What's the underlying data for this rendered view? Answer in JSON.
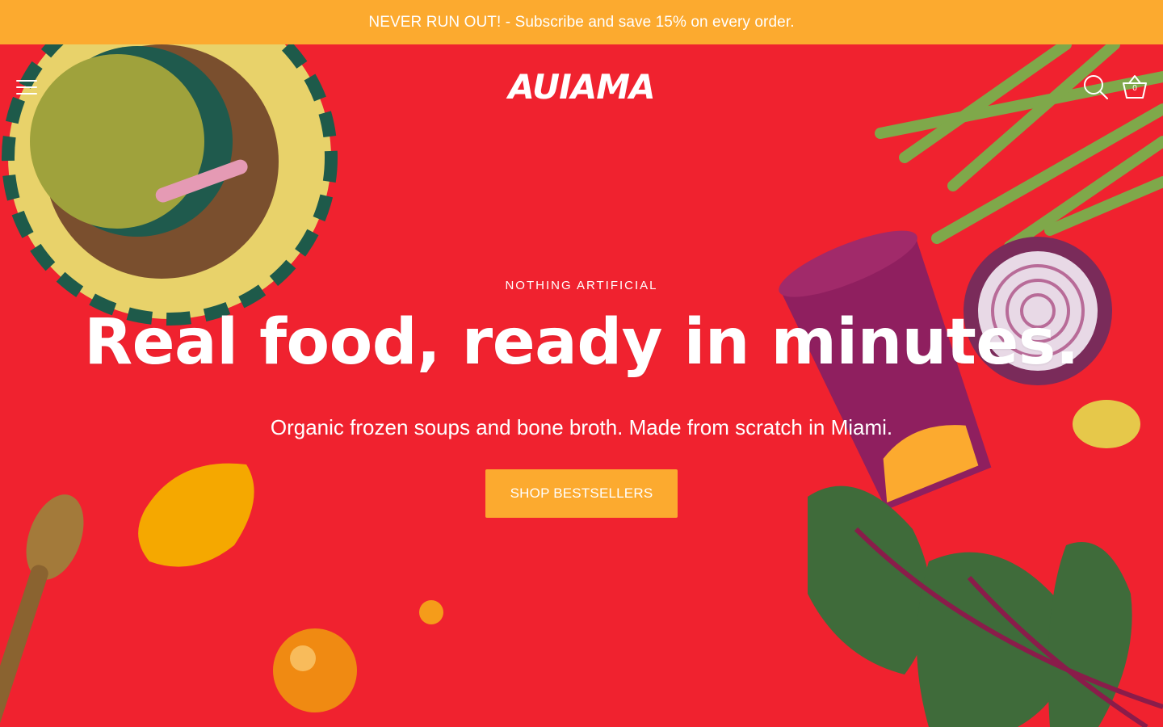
{
  "announcement": {
    "text": "NEVER RUN OUT! - Subscribe and save 15% on every order."
  },
  "header": {
    "logo": "AUIAMA",
    "cart_count": "0"
  },
  "hero": {
    "eyebrow": "NOTHING ARTIFICIAL",
    "headline": "Real food, ready in minutes.",
    "subhead": "Organic frozen soups and bone broth. Made from scratch in Miami.",
    "cta": "SHOP BESTSELLERS"
  },
  "colors": {
    "announcement_bg": "#fcaa2f",
    "hero_bg": "#f0222f",
    "cta_bg": "#fcaa2f",
    "text": "#ffffff"
  },
  "icons": [
    "hamburger-menu-icon",
    "search-icon",
    "basket-icon"
  ]
}
